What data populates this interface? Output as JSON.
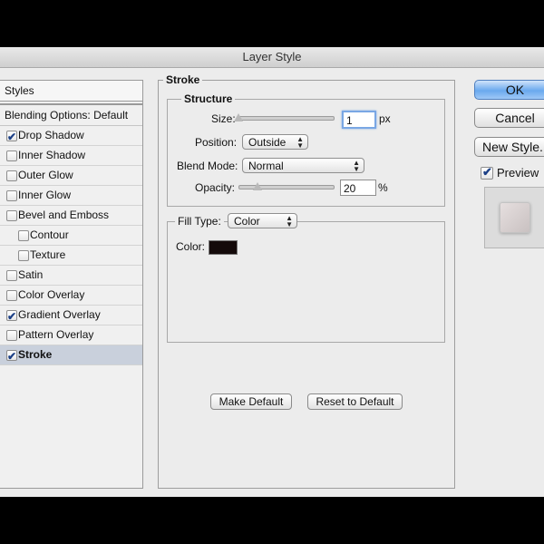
{
  "window": {
    "title": "Layer Style"
  },
  "styles_list": {
    "header": "Styles",
    "blending_options": "Blending Options: Default",
    "items": [
      {
        "label": "Drop Shadow",
        "checked": true
      },
      {
        "label": "Inner Shadow",
        "checked": false
      },
      {
        "label": "Outer Glow",
        "checked": false
      },
      {
        "label": "Inner Glow",
        "checked": false
      },
      {
        "label": "Bevel and Emboss",
        "checked": false
      },
      {
        "label": "Contour",
        "checked": false,
        "indent": true
      },
      {
        "label": "Texture",
        "checked": false,
        "indent": true
      },
      {
        "label": "Satin",
        "checked": false
      },
      {
        "label": "Color Overlay",
        "checked": false
      },
      {
        "label": "Gradient Overlay",
        "checked": true
      },
      {
        "label": "Pattern Overlay",
        "checked": false
      },
      {
        "label": "Stroke",
        "checked": true,
        "selected": true
      }
    ]
  },
  "stroke_panel": {
    "title": "Stroke",
    "structure": {
      "title": "Structure",
      "size_label": "Size:",
      "size_value": "1",
      "size_unit": "px",
      "size_slider_fraction": 0.0,
      "position_label": "Position:",
      "position_value": "Outside",
      "blend_mode_label": "Blend Mode:",
      "blend_mode_value": "Normal",
      "opacity_label": "Opacity:",
      "opacity_value": "20",
      "opacity_unit": "%",
      "opacity_slider_fraction": 0.2
    },
    "fill": {
      "fill_type_label": "Fill Type:",
      "fill_type_value": "Color",
      "color_label": "Color:",
      "color_value": "#140a0a"
    },
    "make_default": "Make Default",
    "reset_default": "Reset to Default"
  },
  "right_panel": {
    "ok": "OK",
    "cancel": "Cancel",
    "new_style": "New Style...",
    "preview_label": "Preview",
    "preview_checked": true
  }
}
